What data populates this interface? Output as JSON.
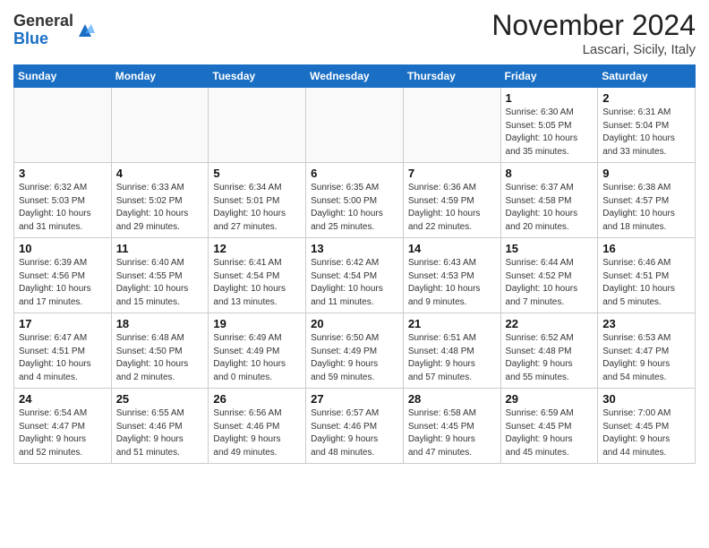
{
  "header": {
    "logo_general": "General",
    "logo_blue": "Blue",
    "month_title": "November 2024",
    "location": "Lascari, Sicily, Italy"
  },
  "weekdays": [
    "Sunday",
    "Monday",
    "Tuesday",
    "Wednesday",
    "Thursday",
    "Friday",
    "Saturday"
  ],
  "weeks": [
    [
      {
        "day": "",
        "info": ""
      },
      {
        "day": "",
        "info": ""
      },
      {
        "day": "",
        "info": ""
      },
      {
        "day": "",
        "info": ""
      },
      {
        "day": "",
        "info": ""
      },
      {
        "day": "1",
        "info": "Sunrise: 6:30 AM\nSunset: 5:05 PM\nDaylight: 10 hours\nand 35 minutes."
      },
      {
        "day": "2",
        "info": "Sunrise: 6:31 AM\nSunset: 5:04 PM\nDaylight: 10 hours\nand 33 minutes."
      }
    ],
    [
      {
        "day": "3",
        "info": "Sunrise: 6:32 AM\nSunset: 5:03 PM\nDaylight: 10 hours\nand 31 minutes."
      },
      {
        "day": "4",
        "info": "Sunrise: 6:33 AM\nSunset: 5:02 PM\nDaylight: 10 hours\nand 29 minutes."
      },
      {
        "day": "5",
        "info": "Sunrise: 6:34 AM\nSunset: 5:01 PM\nDaylight: 10 hours\nand 27 minutes."
      },
      {
        "day": "6",
        "info": "Sunrise: 6:35 AM\nSunset: 5:00 PM\nDaylight: 10 hours\nand 25 minutes."
      },
      {
        "day": "7",
        "info": "Sunrise: 6:36 AM\nSunset: 4:59 PM\nDaylight: 10 hours\nand 22 minutes."
      },
      {
        "day": "8",
        "info": "Sunrise: 6:37 AM\nSunset: 4:58 PM\nDaylight: 10 hours\nand 20 minutes."
      },
      {
        "day": "9",
        "info": "Sunrise: 6:38 AM\nSunset: 4:57 PM\nDaylight: 10 hours\nand 18 minutes."
      }
    ],
    [
      {
        "day": "10",
        "info": "Sunrise: 6:39 AM\nSunset: 4:56 PM\nDaylight: 10 hours\nand 17 minutes."
      },
      {
        "day": "11",
        "info": "Sunrise: 6:40 AM\nSunset: 4:55 PM\nDaylight: 10 hours\nand 15 minutes."
      },
      {
        "day": "12",
        "info": "Sunrise: 6:41 AM\nSunset: 4:54 PM\nDaylight: 10 hours\nand 13 minutes."
      },
      {
        "day": "13",
        "info": "Sunrise: 6:42 AM\nSunset: 4:54 PM\nDaylight: 10 hours\nand 11 minutes."
      },
      {
        "day": "14",
        "info": "Sunrise: 6:43 AM\nSunset: 4:53 PM\nDaylight: 10 hours\nand 9 minutes."
      },
      {
        "day": "15",
        "info": "Sunrise: 6:44 AM\nSunset: 4:52 PM\nDaylight: 10 hours\nand 7 minutes."
      },
      {
        "day": "16",
        "info": "Sunrise: 6:46 AM\nSunset: 4:51 PM\nDaylight: 10 hours\nand 5 minutes."
      }
    ],
    [
      {
        "day": "17",
        "info": "Sunrise: 6:47 AM\nSunset: 4:51 PM\nDaylight: 10 hours\nand 4 minutes."
      },
      {
        "day": "18",
        "info": "Sunrise: 6:48 AM\nSunset: 4:50 PM\nDaylight: 10 hours\nand 2 minutes."
      },
      {
        "day": "19",
        "info": "Sunrise: 6:49 AM\nSunset: 4:49 PM\nDaylight: 10 hours\nand 0 minutes."
      },
      {
        "day": "20",
        "info": "Sunrise: 6:50 AM\nSunset: 4:49 PM\nDaylight: 9 hours\nand 59 minutes."
      },
      {
        "day": "21",
        "info": "Sunrise: 6:51 AM\nSunset: 4:48 PM\nDaylight: 9 hours\nand 57 minutes."
      },
      {
        "day": "22",
        "info": "Sunrise: 6:52 AM\nSunset: 4:48 PM\nDaylight: 9 hours\nand 55 minutes."
      },
      {
        "day": "23",
        "info": "Sunrise: 6:53 AM\nSunset: 4:47 PM\nDaylight: 9 hours\nand 54 minutes."
      }
    ],
    [
      {
        "day": "24",
        "info": "Sunrise: 6:54 AM\nSunset: 4:47 PM\nDaylight: 9 hours\nand 52 minutes."
      },
      {
        "day": "25",
        "info": "Sunrise: 6:55 AM\nSunset: 4:46 PM\nDaylight: 9 hours\nand 51 minutes."
      },
      {
        "day": "26",
        "info": "Sunrise: 6:56 AM\nSunset: 4:46 PM\nDaylight: 9 hours\nand 49 minutes."
      },
      {
        "day": "27",
        "info": "Sunrise: 6:57 AM\nSunset: 4:46 PM\nDaylight: 9 hours\nand 48 minutes."
      },
      {
        "day": "28",
        "info": "Sunrise: 6:58 AM\nSunset: 4:45 PM\nDaylight: 9 hours\nand 47 minutes."
      },
      {
        "day": "29",
        "info": "Sunrise: 6:59 AM\nSunset: 4:45 PM\nDaylight: 9 hours\nand 45 minutes."
      },
      {
        "day": "30",
        "info": "Sunrise: 7:00 AM\nSunset: 4:45 PM\nDaylight: 9 hours\nand 44 minutes."
      }
    ]
  ]
}
